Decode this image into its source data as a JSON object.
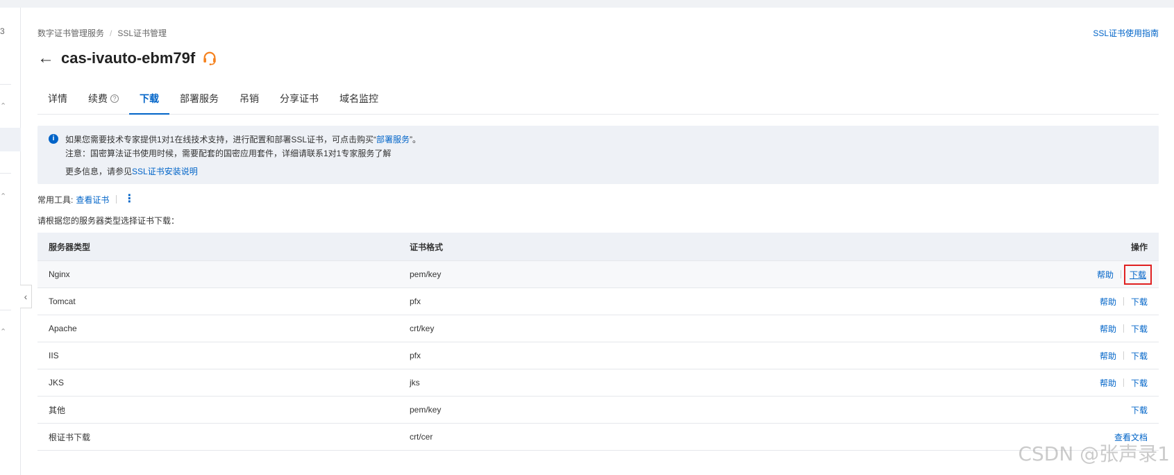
{
  "sidebar": {
    "number": "3",
    "collapse_glyph": "‹"
  },
  "breadcrumb": {
    "items": [
      "数字证书管理服务",
      "SSL证书管理"
    ],
    "separator": "/"
  },
  "guide_link": "SSL证书使用指南",
  "page": {
    "back_glyph": "←",
    "title": "cas-ivauto-ebm79f"
  },
  "tabs": [
    {
      "label": "详情"
    },
    {
      "label": "续费"
    },
    {
      "label": "下载",
      "active": true
    },
    {
      "label": "部署服务"
    },
    {
      "label": "吊销"
    },
    {
      "label": "分享证书"
    },
    {
      "label": "域名监控"
    }
  ],
  "notice": {
    "line1_prefix": "如果您需要技术专家提供1对1在线技术支持，进行配置和部署SSL证书，可点击购买“",
    "line1_link": "部署服务",
    "line1_suffix": "”。",
    "line2": "注意：国密算法证书使用时候，需要配套的国密应用套件，详细请联系1对1专家服务了解",
    "line3_prefix": "更多信息，请参见",
    "line3_link": "SSL证书安装说明"
  },
  "tools": {
    "label": "常用工具:",
    "view_cert": "查看证书",
    "more_glyph": "⋮"
  },
  "hint": "请根据您的服务器类型选择证书下载：",
  "table": {
    "headers": {
      "server": "服务器类型",
      "format": "证书格式",
      "action": "操作"
    },
    "rows": [
      {
        "server": "Nginx",
        "format": "pem/key",
        "help": "帮助",
        "action": "下载"
      },
      {
        "server": "Tomcat",
        "format": "pfx",
        "help": "帮助",
        "action": "下载"
      },
      {
        "server": "Apache",
        "format": "crt/key",
        "help": "帮助",
        "action": "下载"
      },
      {
        "server": "IIS",
        "format": "pfx",
        "help": "帮助",
        "action": "下载"
      },
      {
        "server": "JKS",
        "format": "jks",
        "help": "帮助",
        "action": "下载"
      },
      {
        "server": "其他",
        "format": "pem/key",
        "help": "",
        "action": "下载"
      },
      {
        "server": "根证书下载",
        "format": "crt/cer",
        "help": "",
        "action": "查看文档"
      }
    ]
  },
  "watermark": "CSDN @张声录1",
  "colors": {
    "accent": "#0064c8",
    "support_icon": "#f5821f",
    "highlight_box": "#e02020"
  }
}
